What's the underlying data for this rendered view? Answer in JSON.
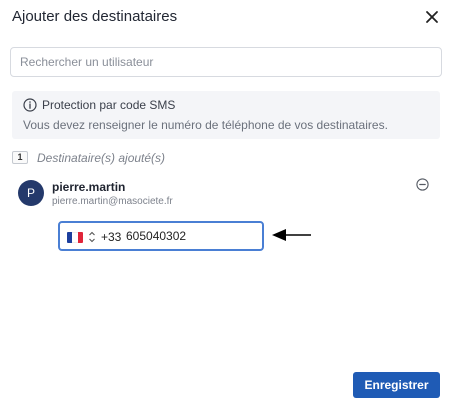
{
  "dialog": {
    "title": "Ajouter des destinataires",
    "close_icon": "close-icon"
  },
  "search": {
    "placeholder": "Rechercher un utilisateur",
    "value": ""
  },
  "notice": {
    "icon": "info-icon",
    "title": "Protection par code SMS",
    "text": "Vous devez renseigner le numéro de téléphone de vos destinataires."
  },
  "recipients": {
    "count": "1",
    "label": "Destinataire(s) ajouté(s)",
    "items": [
      {
        "initial": "P",
        "name": "pierre.martin",
        "email": "pierre.martin@masociete.fr",
        "remove_icon": "minus-circle-icon",
        "phone": {
          "country_flag": "france-flag-icon",
          "stepper_icon": "chevron-updown-icon",
          "dial_code": "+33",
          "number": "605040302"
        }
      }
    ]
  },
  "annotation": {
    "icon": "left-arrow-icon"
  },
  "footer": {
    "save_label": "Enregistrer"
  },
  "colors": {
    "primary": "#1f5bb5",
    "avatar": "#24396b",
    "focus_border": "#4a7fd4",
    "notice_bg": "#f4f5f8"
  }
}
